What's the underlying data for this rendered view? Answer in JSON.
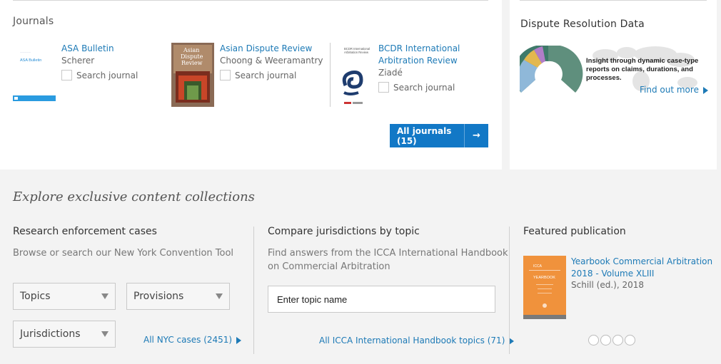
{
  "journals": {
    "heading": "Journals",
    "items": [
      {
        "title_lines": [
          "ASA Bulletin"
        ],
        "author": "Scherer",
        "search_label": "Search journal",
        "cover_text": "ASA Bulletin"
      },
      {
        "title_lines": [
          "Asian Dispute Review"
        ],
        "author": "Choong & Weeramantry",
        "search_label": "Search journal",
        "cover_text": [
          "Asian",
          "Dispute",
          "Review"
        ]
      },
      {
        "title_lines": [
          "BCDR International",
          "Arbitration Review"
        ],
        "author": "Ziadé",
        "search_label": "Search journal",
        "cover_text": [
          "BCDR International",
          "Arbitration Review"
        ]
      }
    ],
    "all_button": {
      "label": "All journals (15)",
      "arrow": "→"
    }
  },
  "dispute_resolution": {
    "heading": "Dispute Resolution Data",
    "description": "Insight through dynamic case-type reports on claims, durations, and processes.",
    "link": "Find out more"
  },
  "explore": {
    "title": "Explore exclusive content collections",
    "enforcement": {
      "title": "Research enforcement cases",
      "description": "Browse or search our New York Convention Tool",
      "dropdowns": [
        {
          "label": "Topics"
        },
        {
          "label": "Provisions"
        },
        {
          "label": "Jurisdictions"
        }
      ],
      "link": "All NYC cases (2451)"
    },
    "compare": {
      "title": "Compare jurisdictions by topic",
      "description_lines": [
        "Find answers from the ICCA International Handbook",
        "on Commercial Arbitration"
      ],
      "input_placeholder": "Enter topic name",
      "link": "All ICCA International Handbook topics (71)"
    },
    "featured": {
      "title": "Featured publication",
      "pub_title_lines": [
        "Yearbook Commercial Arbitration",
        "2018 - Volume XLIII"
      ],
      "pub_meta": "Schill (ed.), 2018",
      "cover_text": [
        "ICCA",
        "YEARBOOK"
      ],
      "carousel_count": 4
    }
  },
  "colors": {
    "link": "#1d7ab6",
    "button": "#1278c6",
    "yearbook_orange": "#f0923c"
  }
}
